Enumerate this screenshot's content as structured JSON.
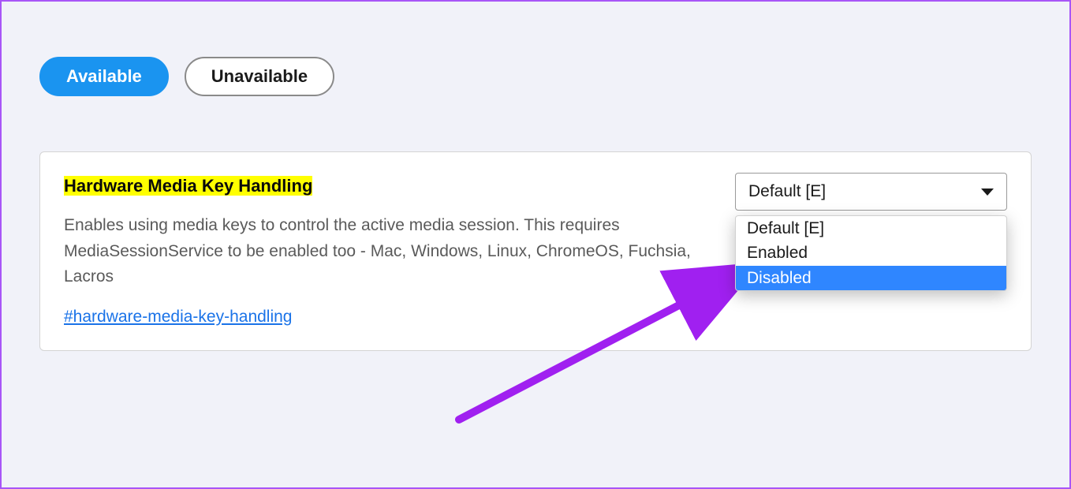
{
  "tabs": {
    "available": "Available",
    "unavailable": "Unavailable"
  },
  "flag": {
    "title": "Hardware Media Key Handling",
    "description": "Enables using media keys to control the active media session. This requires MediaSessionService to be enabled too - Mac, Windows, Linux, ChromeOS, Fuchsia, Lacros",
    "link": "#hardware-media-key-handling",
    "select_value": "Default [E]",
    "options": {
      "default": "Default [E]",
      "enabled": "Enabled",
      "disabled": "Disabled"
    }
  }
}
